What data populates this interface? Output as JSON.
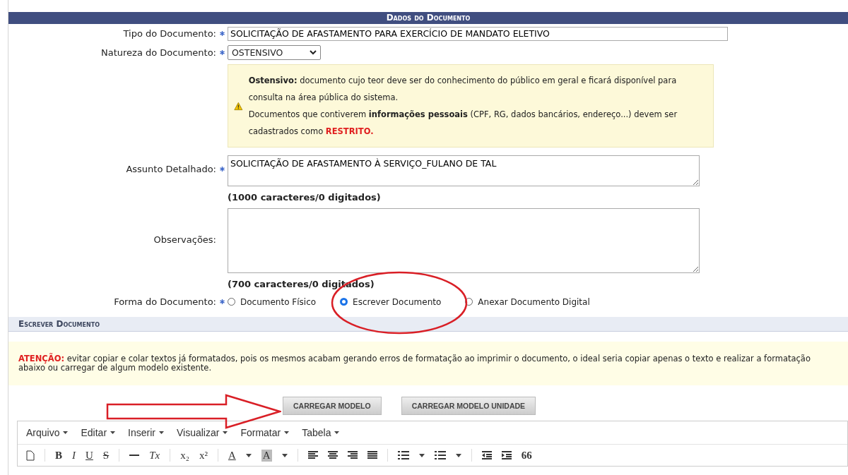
{
  "section_title": "Dados do Documento",
  "tipo": {
    "label": "Tipo do Documento:",
    "value": "SOLICITAÇÃO DE AFASTAMENTO PARA EXERCÍCIO DE MANDATO ELETIVO"
  },
  "natureza": {
    "label": "Natureza do Documento:",
    "value": "OSTENSIVO"
  },
  "notice": {
    "line1": "**Ostensivo:** documento cujo teor deve ser do conhecimento do público em geral e ficará disponível para consulta na área pública do sistema.",
    "line2": "Documentos que contiverem **informações pessoais** (CPF, RG, dados bancários, endereço...) devem ser cadastrados como",
    "restrito": "RESTRITO."
  },
  "assunto": {
    "label": "Assunto Detalhado:",
    "value": "SOLICITAÇÃO DE AFASTAMENTO À SERVIÇO_FULANO DE TAL",
    "counter": "(1000 caracteres/0 digitados)"
  },
  "observacoes": {
    "label": "Observações:",
    "counter": "(700 caracteres/0 digitados)"
  },
  "forma": {
    "label": "Forma do Documento:",
    "options": [
      {
        "label": "Documento Físico",
        "selected": false
      },
      {
        "label": "Escrever Documento",
        "selected": true
      },
      {
        "label": "Anexar Documento Digital",
        "selected": false
      }
    ]
  },
  "escrever_title": "Escrever Documento",
  "atencao": {
    "prefix": "ATENÇÃO:",
    "text": "evitar copiar e colar textos já formatados, pois os mesmos acabam gerando erros de formatação ao imprimir o documento, o ideal seria copiar apenas o texto e realizar a formatação abaixo ou carregar de algum modelo existente."
  },
  "buttons": [
    "CARREGAR MODELO",
    "CARREGAR MODELO UNIDADE"
  ],
  "editor_menu": [
    "Arquivo",
    "Editar",
    "Inserir",
    "Visualizar",
    "Formatar",
    "Tabela"
  ],
  "toolbar": [
    {
      "kind": "new"
    },
    {
      "kind": "sep"
    },
    {
      "kind": "bold",
      "label": "B"
    },
    {
      "kind": "italic",
      "label": "I"
    },
    {
      "kind": "underline",
      "label": "U"
    },
    {
      "kind": "strike",
      "label": "S"
    },
    {
      "kind": "sep"
    },
    {
      "kind": "hr"
    },
    {
      "kind": "italic",
      "label": "Tx"
    },
    {
      "kind": "sep"
    },
    {
      "kind": "plain",
      "label": "x₂"
    },
    {
      "kind": "plain",
      "label": "x²"
    },
    {
      "kind": "sep"
    },
    {
      "kind": "color",
      "label": "A"
    },
    {
      "kind": "caret"
    },
    {
      "kind": "highlight",
      "label": "A"
    },
    {
      "kind": "caret"
    },
    {
      "kind": "sep"
    },
    {
      "kind": "align-left"
    },
    {
      "kind": "align-center"
    },
    {
      "kind": "align-right"
    },
    {
      "kind": "justify"
    },
    {
      "kind": "sep"
    },
    {
      "kind": "bullets"
    },
    {
      "kind": "caret"
    },
    {
      "kind": "numbers"
    },
    {
      "kind": "caret"
    },
    {
      "kind": "sep"
    },
    {
      "kind": "outdent"
    },
    {
      "kind": "indent"
    },
    {
      "kind": "bold",
      "label": "66"
    }
  ]
}
